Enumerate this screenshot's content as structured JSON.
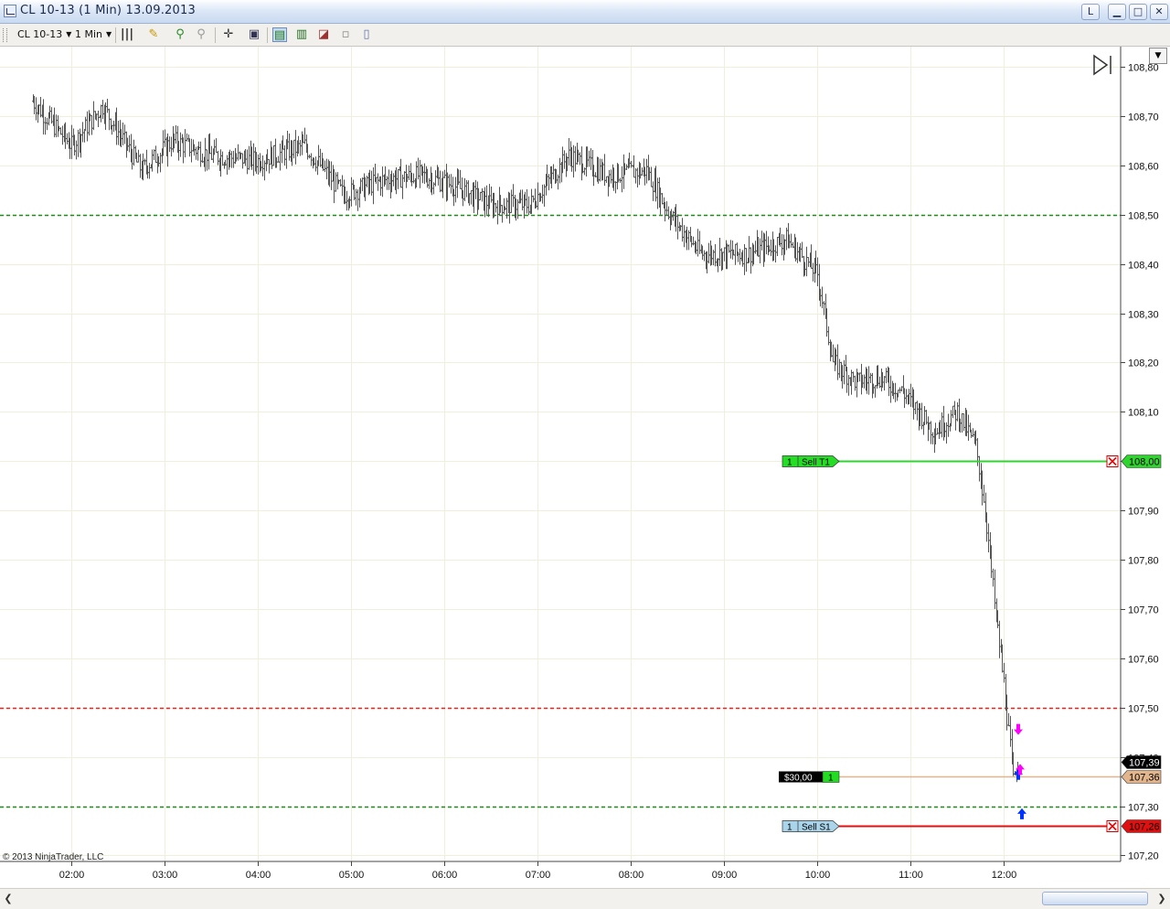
{
  "window": {
    "title": "CL 10-13 (1 Min)  13.09.2013",
    "link_button": "L",
    "minimize_glyph": "▁",
    "maximize_glyph": "□",
    "close_glyph": "✕"
  },
  "toolbar": {
    "instrument": "CL 10-13",
    "interval": "1 Min",
    "icons": [
      "bar-style-icon",
      "drawing-tools-icon",
      "zoom-in-icon",
      "zoom-out-icon",
      "crosshair-icon",
      "data-box-icon",
      "chart-trader-icon",
      "strategies-icon",
      "indicators-icon",
      "templates-icon",
      "properties-icon"
    ]
  },
  "chart_data": {
    "type": "ohlc-bar",
    "instrument": "CL 10-13",
    "interval": "1 Min",
    "date": "13.09.2013",
    "copyright": "© 2013 NinjaTrader, LLC",
    "x_tick_labels": [
      "02:00",
      "03:00",
      "04:00",
      "05:00",
      "06:00",
      "07:00",
      "08:00",
      "09:00",
      "10:00",
      "11:00",
      "12:00"
    ],
    "y_tick_labels": [
      "108,80",
      "108,70",
      "108,60",
      "108,50",
      "108,40",
      "108,30",
      "108,20",
      "108,10",
      "108,00",
      "107,90",
      "107,80",
      "107,70",
      "107,60",
      "107,50",
      "107,40",
      "107,30",
      "107,20"
    ],
    "y_range": [
      107.18,
      108.82
    ],
    "grid": true,
    "price_waypoints": [
      {
        "t": "01:35",
        "p": 108.73
      },
      {
        "t": "02:00",
        "p": 108.64
      },
      {
        "t": "02:20",
        "p": 108.72
      },
      {
        "t": "02:45",
        "p": 108.59
      },
      {
        "t": "03:05",
        "p": 108.65
      },
      {
        "t": "03:30",
        "p": 108.62
      },
      {
        "t": "04:00",
        "p": 108.61
      },
      {
        "t": "04:30",
        "p": 108.64
      },
      {
        "t": "04:55",
        "p": 108.54
      },
      {
        "t": "05:20",
        "p": 108.57
      },
      {
        "t": "05:45",
        "p": 108.58
      },
      {
        "t": "06:05",
        "p": 108.56
      },
      {
        "t": "06:30",
        "p": 108.52
      },
      {
        "t": "06:55",
        "p": 108.52
      },
      {
        "t": "07:20",
        "p": 108.62
      },
      {
        "t": "07:45",
        "p": 108.58
      },
      {
        "t": "08:10",
        "p": 108.59
      },
      {
        "t": "08:25",
        "p": 108.5
      },
      {
        "t": "08:45",
        "p": 108.42
      },
      {
        "t": "09:15",
        "p": 108.42
      },
      {
        "t": "09:40",
        "p": 108.45
      },
      {
        "t": "10:00",
        "p": 108.38
      },
      {
        "t": "10:10",
        "p": 108.2
      },
      {
        "t": "10:25",
        "p": 108.16
      },
      {
        "t": "10:40",
        "p": 108.17
      },
      {
        "t": "10:55",
        "p": 108.14
      },
      {
        "t": "11:05",
        "p": 108.1
      },
      {
        "t": "11:15",
        "p": 108.06
      },
      {
        "t": "11:30",
        "p": 108.1
      },
      {
        "t": "11:42",
        "p": 108.03
      },
      {
        "t": "11:48",
        "p": 107.9
      },
      {
        "t": "11:55",
        "p": 107.68
      },
      {
        "t": "12:00",
        "p": 107.55
      },
      {
        "t": "12:03",
        "p": 107.45
      },
      {
        "t": "12:06",
        "p": 107.35
      },
      {
        "t": "12:09",
        "p": 107.39
      }
    ],
    "horizontal_lines": [
      {
        "price": 108.5,
        "color": "#1c8a1c",
        "style": "dashed"
      },
      {
        "price": 107.5,
        "color": "#e82020",
        "style": "dashed"
      },
      {
        "price": 107.3,
        "color": "#1c8a1c",
        "style": "dashed"
      }
    ],
    "orders": [
      {
        "qty": "1",
        "label": "Sell T1",
        "price": 108.0,
        "price_label": "108,00",
        "color": "#2fd42f",
        "tag_color": "#25dd25"
      },
      {
        "qty": "1",
        "label": "Sell S1",
        "price": 107.26,
        "price_label": "107,26",
        "color": "#e01010",
        "tag_color": "#a9d4ea"
      }
    ],
    "position": {
      "pnl": "$30,00",
      "qty": "1",
      "price": 107.36,
      "price_label": "107,36",
      "color": "#e2b58c"
    },
    "last_price": {
      "price": 107.39,
      "label": "107,39"
    },
    "executions": [
      {
        "t": "12:06",
        "price": 107.45,
        "dir": "down",
        "color": "#ff00ff"
      },
      {
        "t": "12:06",
        "price": 107.37,
        "dir": "up",
        "color": "#0033ff"
      },
      {
        "t": "12:07",
        "price": 107.38,
        "dir": "up",
        "color": "#ff00ff"
      },
      {
        "t": "12:08",
        "price": 107.29,
        "dir": "up",
        "color": "#0033ff"
      }
    ]
  }
}
